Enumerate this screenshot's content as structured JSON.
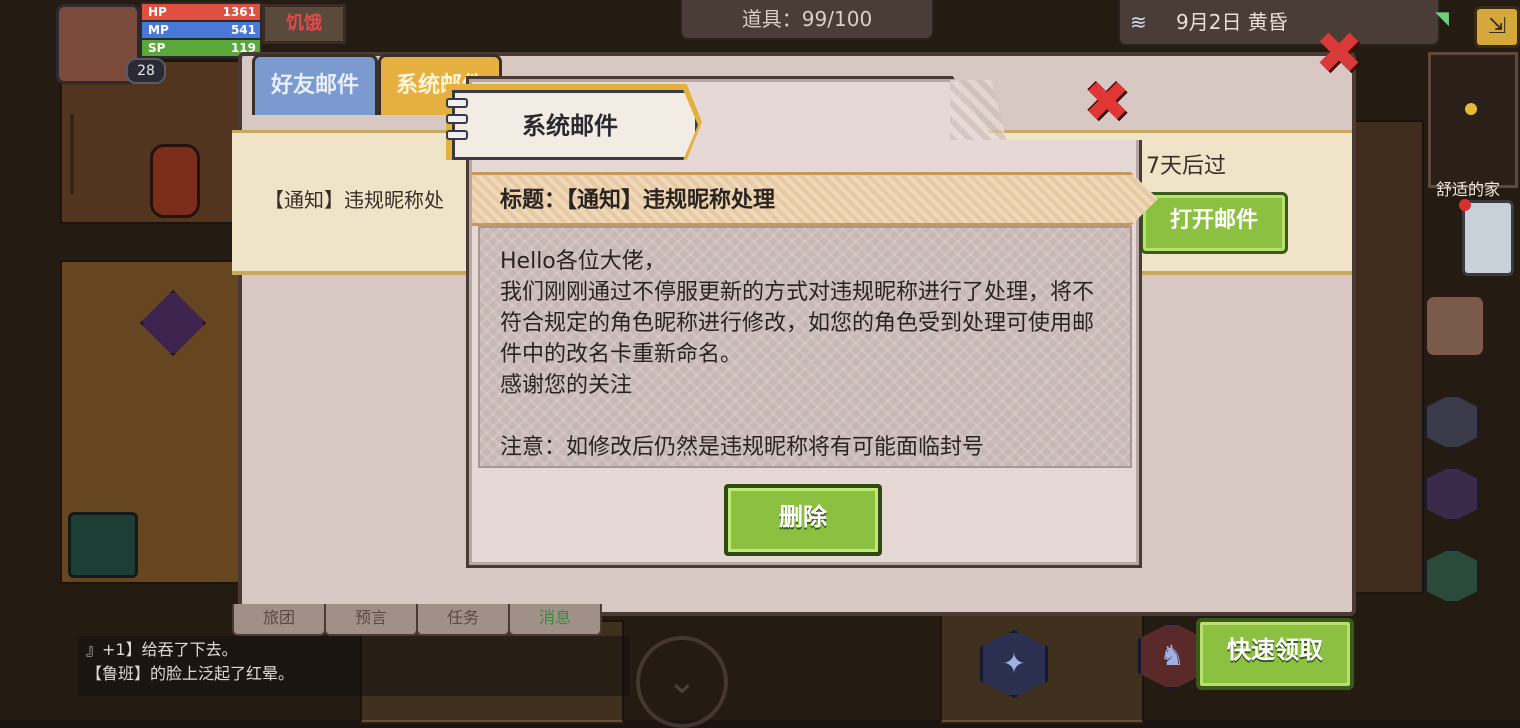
{
  "hud": {
    "level": "28",
    "hp_label": "HP",
    "hp_value": "1361",
    "mp_label": "MP",
    "mp_value": "541",
    "sp_label": "SP",
    "sp_value": "119",
    "status": "饥饿",
    "items": "道具：99/100",
    "date": "9月2日 黄昏",
    "location": "舒适的家"
  },
  "mail": {
    "tabs": [
      "好友邮件",
      "系统邮件"
    ],
    "row": {
      "title": "【通知】违规昵称处",
      "expiry": "7天后过",
      "open_button": "打开邮件"
    },
    "bottom_tabs": [
      "旅团",
      "预言",
      "任务",
      "消息"
    ]
  },
  "detail": {
    "header": "系统邮件",
    "subject": "标题：【通知】违规昵称处理",
    "body": "Hello各位大佬，\n我们刚刚通过不停服更新的方式对违规昵称进行了处理，将不符合规定的角色昵称进行修改，如您的角色受到处理可使用邮件中的改名卡重新命名。\n感谢您的关注\n\n注意：如修改后仍然是违规昵称将有可能面临封号",
    "delete_button": "删除"
  },
  "chat": {
    "line1": "』+1】给吞了下去。",
    "line2": "【鲁班】的脸上泛起了红晕。"
  },
  "quick_claim": "快速领取",
  "colors": {
    "hp": "#e05040",
    "mp": "#4a78d8",
    "sp": "#5aa83a",
    "green_button": "#8cc040",
    "close_red": "#e03636"
  },
  "icons": [
    "close-icon",
    "weather-icon",
    "wifi-icon",
    "exit-icon",
    "notification-dot"
  ]
}
